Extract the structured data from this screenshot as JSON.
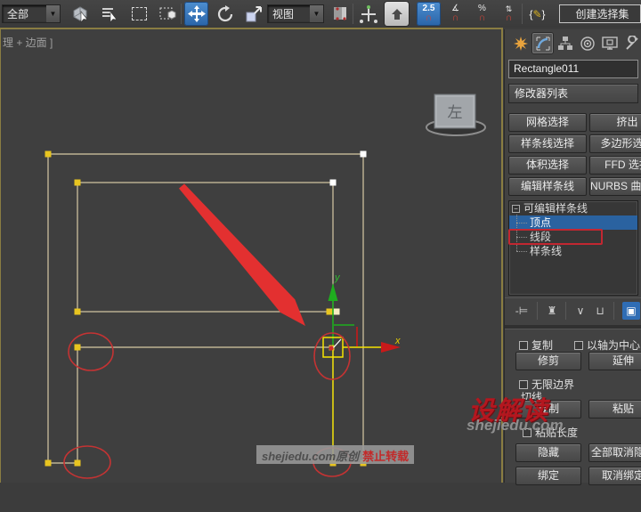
{
  "toolbar": {
    "filter_dropdown": "全部",
    "coord_dropdown": "视图",
    "snap_label": "2.5",
    "percent_label": "%",
    "selection_set_field": "创建选择集"
  },
  "viewport": {
    "label": "理 + 边面 ]",
    "viewcube_face": "左",
    "axis_x_label": "x",
    "axis_y_label": "y",
    "watermark_text": "shejiedu.com原创",
    "watermark_warn": "禁止转载"
  },
  "watermark": {
    "brand": "设解读",
    "site": "shejiedu.com"
  },
  "panel": {
    "object_name": "Rectangle011",
    "modifier_list_label": "修改器列表",
    "grid": [
      [
        "网格选择",
        "挤出"
      ],
      [
        "样条线选择",
        "多边形选择"
      ],
      [
        "体积选择",
        "FFD 选择"
      ],
      [
        "编辑样条线",
        "NURBS 曲面选择"
      ]
    ],
    "stack": {
      "root": "可编辑样条线",
      "items": [
        "顶点",
        "线段",
        "样条线"
      ]
    },
    "rollout": {
      "cb_copy": "复制",
      "cb_axis_center": "以轴为中心",
      "trim": "修剪",
      "extend": "延伸",
      "infinite_bounds": "无限边界",
      "tangent_label": "切线",
      "copy": "复制",
      "paste": "粘贴",
      "paste_length": "粘贴长度",
      "hide": "隐藏",
      "unhide_all": "全部取消隐藏",
      "bind": "绑定",
      "unbind": "取消绑定"
    }
  },
  "colors": {
    "accent_blue": "#2f6db5",
    "spline_cream": "#d8c9a4",
    "selected_yellow": "#f5e400",
    "annotation_red": "#d32a2a",
    "gizmo_green": "#1fae1f",
    "gizmo_red": "#c81a1a"
  }
}
